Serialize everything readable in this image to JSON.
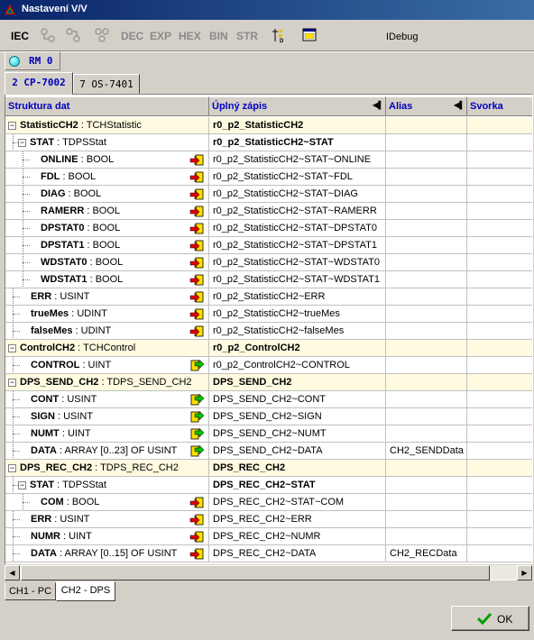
{
  "window": {
    "title": "Nastavení V/V"
  },
  "toolbar": {
    "iec": "IEC",
    "dec": "DEC",
    "exp": "EXP",
    "hex": "HEX",
    "bin": "BIN",
    "str": "STR",
    "debug": "IDebug",
    "icons": [
      "step-icon",
      "step-icon",
      "step-icon",
      "step-icon",
      "insert-icon",
      "window-icon"
    ]
  },
  "rm": {
    "label": "RM 0",
    "led_color": "#00c8d8"
  },
  "module_tabs": [
    {
      "label": "2 CP-7002",
      "active": true
    },
    {
      "label": "7 OS-7401",
      "active": false
    }
  ],
  "columns": [
    "Struktura dat",
    "Úplný zápis",
    "Alias",
    "Svorka"
  ],
  "rows": [
    {
      "name": "StatisticCH2",
      "type": " : TCHStatistic",
      "full": "r0_p2_StatisticCH2",
      "alias": "",
      "svorka": "",
      "group": true,
      "dir": ""
    },
    {
      "name": "STAT",
      "type": " : TDPSStat",
      "full": "r0_p2_StatisticCH2~STAT",
      "alias": "",
      "svorka": "",
      "group": true,
      "dir": ""
    },
    {
      "name": "ONLINE",
      "type": " : BOOL",
      "full": "r0_p2_StatisticCH2~STAT~ONLINE",
      "alias": "",
      "svorka": "",
      "group": false,
      "dir": "in"
    },
    {
      "name": "FDL",
      "type": " : BOOL",
      "full": "r0_p2_StatisticCH2~STAT~FDL",
      "alias": "",
      "svorka": "",
      "group": false,
      "dir": "in"
    },
    {
      "name": "DIAG",
      "type": " : BOOL",
      "full": "r0_p2_StatisticCH2~STAT~DIAG",
      "alias": "",
      "svorka": "",
      "group": false,
      "dir": "in"
    },
    {
      "name": "RAMERR",
      "type": " : BOOL",
      "full": "r0_p2_StatisticCH2~STAT~RAMERR",
      "alias": "",
      "svorka": "",
      "group": false,
      "dir": "in"
    },
    {
      "name": "DPSTAT0",
      "type": " : BOOL",
      "full": "r0_p2_StatisticCH2~STAT~DPSTAT0",
      "alias": "",
      "svorka": "",
      "group": false,
      "dir": "in"
    },
    {
      "name": "DPSTAT1",
      "type": " : BOOL",
      "full": "r0_p2_StatisticCH2~STAT~DPSTAT1",
      "alias": "",
      "svorka": "",
      "group": false,
      "dir": "in"
    },
    {
      "name": "WDSTAT0",
      "type": " : BOOL",
      "full": "r0_p2_StatisticCH2~STAT~WDSTAT0",
      "alias": "",
      "svorka": "",
      "group": false,
      "dir": "in"
    },
    {
      "name": "WDSTAT1",
      "type": " : BOOL",
      "full": "r0_p2_StatisticCH2~STAT~WDSTAT1",
      "alias": "",
      "svorka": "",
      "group": false,
      "dir": "in"
    },
    {
      "name": "ERR",
      "type": " : USINT",
      "full": "r0_p2_StatisticCH2~ERR",
      "alias": "",
      "svorka": "",
      "group": false,
      "dir": "in"
    },
    {
      "name": "trueMes",
      "type": " : UDINT",
      "full": "r0_p2_StatisticCH2~trueMes",
      "alias": "",
      "svorka": "",
      "group": false,
      "dir": "in"
    },
    {
      "name": "falseMes",
      "type": " : UDINT",
      "full": "r0_p2_StatisticCH2~falseMes",
      "alias": "",
      "svorka": "",
      "group": false,
      "dir": "in"
    },
    {
      "name": "ControlCH2",
      "type": " : TCHControl",
      "full": "r0_p2_ControlCH2",
      "alias": "",
      "svorka": "",
      "group": true,
      "dir": ""
    },
    {
      "name": "CONTROL",
      "type": " : UINT",
      "full": "r0_p2_ControlCH2~CONTROL",
      "alias": "",
      "svorka": "",
      "group": false,
      "dir": "out"
    },
    {
      "name": "DPS_SEND_CH2",
      "type": " : TDPS_SEND_CH2",
      "full": "DPS_SEND_CH2",
      "alias": "",
      "svorka": "",
      "group": true,
      "dir": ""
    },
    {
      "name": "CONT",
      "type": " : USINT",
      "full": "DPS_SEND_CH2~CONT",
      "alias": "",
      "svorka": "",
      "group": false,
      "dir": "out"
    },
    {
      "name": "SIGN",
      "type": " : USINT",
      "full": "DPS_SEND_CH2~SIGN",
      "alias": "",
      "svorka": "",
      "group": false,
      "dir": "out"
    },
    {
      "name": "NUMT",
      "type": " : UINT",
      "full": "DPS_SEND_CH2~NUMT",
      "alias": "",
      "svorka": "",
      "group": false,
      "dir": "out"
    },
    {
      "name": "DATA",
      "type": " : ARRAY [0..23] OF USINT",
      "full": "DPS_SEND_CH2~DATA",
      "alias": "CH2_SENDData",
      "svorka": "",
      "group": false,
      "dir": "out"
    },
    {
      "name": "DPS_REC_CH2",
      "type": " : TDPS_REC_CH2",
      "full": "DPS_REC_CH2",
      "alias": "",
      "svorka": "",
      "group": true,
      "dir": ""
    },
    {
      "name": "STAT",
      "type": " : TDPSStat",
      "full": "DPS_REC_CH2~STAT",
      "alias": "",
      "svorka": "",
      "group": true,
      "dir": ""
    },
    {
      "name": "COM",
      "type": " : BOOL",
      "full": "DPS_REC_CH2~STAT~COM",
      "alias": "",
      "svorka": "",
      "group": false,
      "dir": "in"
    },
    {
      "name": "ERR",
      "type": " : USINT",
      "full": "DPS_REC_CH2~ERR",
      "alias": "",
      "svorka": "",
      "group": false,
      "dir": "in"
    },
    {
      "name": "NUMR",
      "type": " : UINT",
      "full": "DPS_REC_CH2~NUMR",
      "alias": "",
      "svorka": "",
      "group": false,
      "dir": "in"
    },
    {
      "name": "DATA",
      "type": " : ARRAY [0..15] OF USINT",
      "full": "DPS_REC_CH2~DATA",
      "alias": "CH2_RECData",
      "svorka": "",
      "group": false,
      "dir": "in"
    }
  ],
  "channel_tabs": [
    {
      "label": "CH1 - PC",
      "active": false
    },
    {
      "label": "CH2 - DPS",
      "active": true
    }
  ],
  "ok_button": {
    "label": "OK"
  },
  "colors": {
    "title_bar": "#0a246a",
    "header_text": "#0000c0",
    "group_row_bg": "#fffae0",
    "in_arrow": "#e00000",
    "out_arrow": "#00c000",
    "tag_yellow": "#ffe000"
  }
}
